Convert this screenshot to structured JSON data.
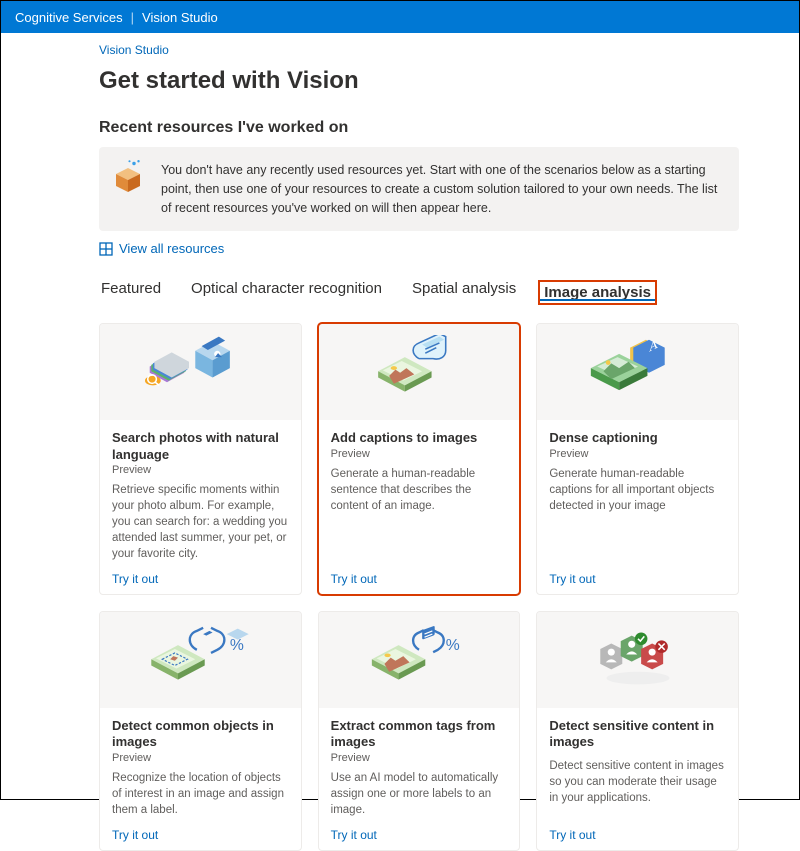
{
  "header": {
    "product": "Cognitive Services",
    "section": "Vision Studio"
  },
  "breadcrumb": "Vision Studio",
  "page_title": "Get started with Vision",
  "recent": {
    "heading": "Recent resources I've worked on",
    "empty_text": "You don't have any recently used resources yet. Start with one of the scenarios below as a starting point, then use one of your resources to create a custom solution tailored to your own needs. The list of recent resources you've worked on will then appear here.",
    "view_all": "View all resources"
  },
  "tabs": [
    "Featured",
    "Optical character recognition",
    "Spatial analysis",
    "Image analysis"
  ],
  "active_tab_index": 3,
  "cards": [
    {
      "title": "Search photos with natural language",
      "badge": "Preview",
      "desc": "Retrieve specific moments within your photo album. For example, you can search for: a wedding you attended last summer, your pet, or your favorite city.",
      "cta": "Try it out"
    },
    {
      "title": "Add captions to images",
      "badge": "Preview",
      "desc": "Generate a human-readable sentence that describes the content of an image.",
      "cta": "Try it out"
    },
    {
      "title": "Dense captioning",
      "badge": "Preview",
      "desc": "Generate human-readable captions for all important objects detected in your image",
      "cta": "Try it out"
    },
    {
      "title": "Detect common objects in images",
      "badge": "Preview",
      "desc": "Recognize the location of objects of interest in an image and assign them a label.",
      "cta": "Try it out"
    },
    {
      "title": "Extract common tags from images",
      "badge": "Preview",
      "desc": "Use an AI model to automatically assign one or more labels to an image.",
      "cta": "Try it out"
    },
    {
      "title": "Detect sensitive content in images",
      "badge": "",
      "desc": "Detect sensitive content in images so you can moderate their usage in your applications.",
      "cta": "Try it out"
    }
  ],
  "highlight_card_index": 1
}
